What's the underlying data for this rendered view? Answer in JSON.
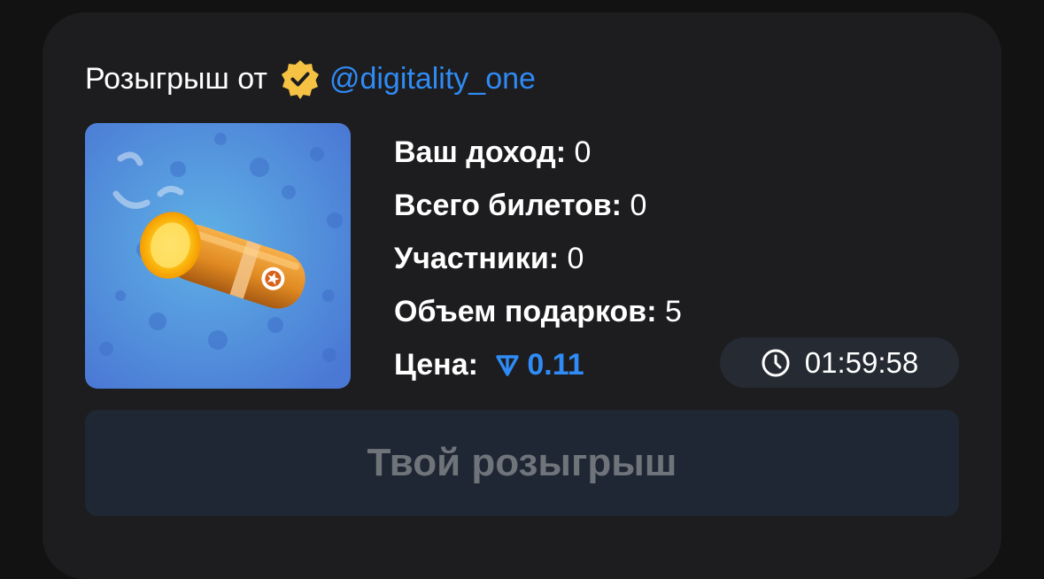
{
  "header": {
    "prefix": "Розыгрыш от",
    "handle": "@digitality_one",
    "verified_icon": "verified-badge-icon"
  },
  "gift": {
    "image_icon": "cigar-gift-icon",
    "background_color": "#4f8fd6"
  },
  "stats": {
    "income_label": "Ваш доход:",
    "income_value": "0",
    "tickets_label": "Всего билетов:",
    "tickets_value": "0",
    "participants_label": "Участники:",
    "participants_value": "0",
    "gifts_label": "Объем подарков:",
    "gifts_value": "5",
    "price_label": "Цена:",
    "price_icon": "ton-icon",
    "price_value": "0.11"
  },
  "timer": {
    "icon": "clock-icon",
    "value": "01:59:58"
  },
  "cta": {
    "label": "Твой розыгрыш",
    "disabled": true
  },
  "colors": {
    "accent": "#2f8bf5",
    "badge": "#f5c244",
    "card": "#1d1d1f",
    "button_bg": "#1e2733",
    "button_text": "#6f737a"
  }
}
